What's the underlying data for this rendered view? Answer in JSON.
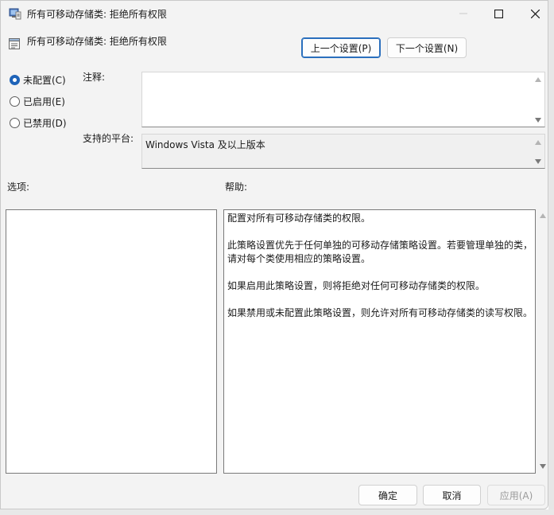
{
  "window": {
    "title": "所有可移动存储类: 拒绝所有权限"
  },
  "header": {
    "policy_title": "所有可移动存储类: 拒绝所有权限",
    "prev_label": "上一个设置(P)",
    "next_label": "下一个设置(N)"
  },
  "state": {
    "options": [
      {
        "label": "未配置(C)",
        "checked": true
      },
      {
        "label": "已启用(E)",
        "checked": false
      },
      {
        "label": "已禁用(D)",
        "checked": false
      }
    ]
  },
  "comment": {
    "label": "注释:",
    "value": ""
  },
  "platform": {
    "label": "支持的平台:",
    "value": "Windows Vista 及以上版本"
  },
  "sections": {
    "options_label": "选项:",
    "help_label": "帮助:"
  },
  "help": {
    "paragraphs": [
      "配置对所有可移动存储类的权限。",
      "此策略设置优先于任何单独的可移动存储策略设置。若要管理单独的类，请对每个类使用相应的策略设置。",
      "如果启用此策略设置，则将拒绝对任何可移动存储类的权限。",
      "如果禁用或未配置此策略设置，则允许对所有可移动存储类的读写权限。"
    ]
  },
  "footer": {
    "ok_label": "确定",
    "cancel_label": "取消",
    "apply_label": "应用(A)"
  },
  "colors": {
    "accent": "#1e63b8",
    "window_bg": "#f3f3f3",
    "pane_bg": "#ffffff",
    "disabled_text": "#9a9a9a"
  },
  "icons": {
    "title_icon": "policy-settings-icon",
    "minimize": "minimize-icon",
    "maximize": "maximize-icon",
    "close": "close-icon"
  }
}
